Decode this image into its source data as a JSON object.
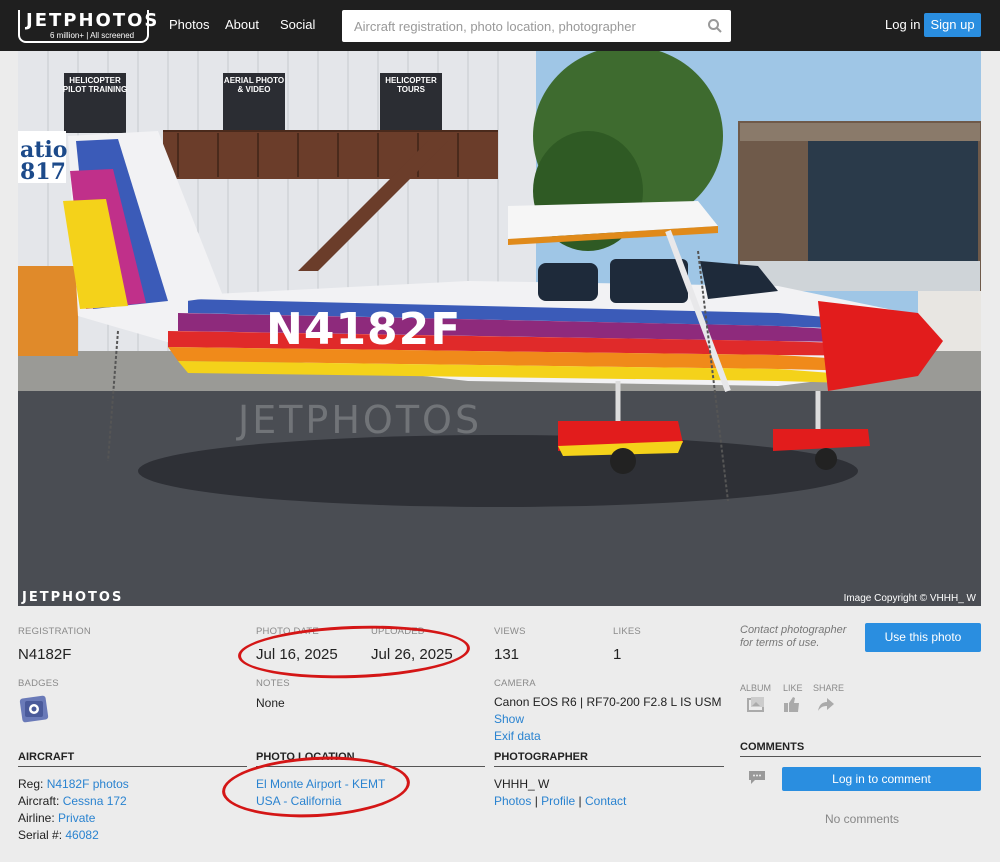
{
  "header": {
    "logo_text": "JETPHOTOS",
    "logo_sub": "6 million+ | All screened",
    "nav": [
      "Photos",
      "About",
      "Social"
    ],
    "search_placeholder": "Aircraft registration, photo location, photographer",
    "login": "Log in",
    "signup": "Sign up"
  },
  "photo": {
    "registration_on_plane": "N4182F",
    "watermark": "JETPHOTOS",
    "footer_logo": "JETPHOTOS",
    "copyright": "Image Copyright © VHHH_ W",
    "sign_1": "HELICOPTER PILOT TRAINING",
    "sign_2": "AERIAL PHOTO & VIDEO",
    "sign_3": "HELICOPTER TOURS"
  },
  "details": {
    "registration_label": "REGISTRATION",
    "registration": "N4182F",
    "photo_date_label": "PHOTO DATE",
    "photo_date": "Jul 16, 2025",
    "uploaded_label": "UPLOADED",
    "uploaded": "Jul 26, 2025",
    "views_label": "VIEWS",
    "views": "131",
    "likes_label": "LIKES",
    "likes": "1",
    "badges_label": "BADGES",
    "notes_label": "NOTES",
    "notes": "None",
    "camera_label": "CAMERA",
    "camera": "Canon EOS R6 | RF70-200 F2.8 L IS USM",
    "camera_show": "Show",
    "camera_exif": "Exif data"
  },
  "aircraft": {
    "title": "AIRCRAFT",
    "reg_label": "Reg:",
    "reg_link": "N4182F photos",
    "aircraft_label": "Aircraft:",
    "aircraft_link": "Cessna 172",
    "airline_label": "Airline:",
    "airline_link": "Private",
    "serial_label": "Serial #:",
    "serial_link": "46082"
  },
  "location": {
    "title": "PHOTO LOCATION",
    "airport": "El Monte Airport - KEMT",
    "region": "USA - California"
  },
  "photographer": {
    "title": "PHOTOGRAPHER",
    "name": "VHHH_ W",
    "links": [
      "Photos",
      "Profile",
      "Contact"
    ],
    "separator": "|"
  },
  "sidebar": {
    "contact_note": "Contact photographer for terms of use.",
    "use_photo": "Use this photo",
    "album": "ALBUM",
    "like": "LIKE",
    "share": "SHARE",
    "comments_title": "COMMENTS",
    "login_to_comment": "Log in to comment",
    "no_comments": "No comments"
  },
  "colors": {
    "accent": "#2a8ee0",
    "link": "#2a83d0",
    "annotation": "#d41616",
    "topbar": "#1f1f1f"
  }
}
